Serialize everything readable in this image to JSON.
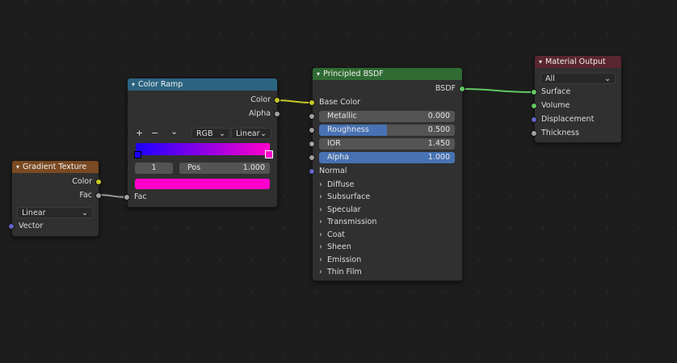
{
  "nodes": {
    "gradient": {
      "title": "Gradient Texture",
      "color_header": "#7a4a22",
      "outputs": {
        "color": "Color",
        "fac": "Fac"
      },
      "type_value": "Linear",
      "input_vector": "Vector"
    },
    "colorramp": {
      "title": "Color Ramp",
      "color_header": "#2b6482",
      "outputs": {
        "color": "Color",
        "alpha": "Alpha"
      },
      "toolbar": {
        "add": "+",
        "remove": "−",
        "menu": "⌄"
      },
      "color_mode": "RGB",
      "interpolation": "Linear",
      "stop_index": "1",
      "pos_label": "Pos",
      "pos_value": "1.000",
      "ramp_start_color": "#1a00ff",
      "ramp_end_color": "#ff00cc",
      "active_color": "#ff00cc",
      "input_fac": "Fac"
    },
    "principled": {
      "title": "Principled BSDF",
      "color_header": "#2f6b32",
      "output_bsdf": "BSDF",
      "base_color": "Base Color",
      "metallic": {
        "label": "Metallic",
        "value": "0.000",
        "fill": 0
      },
      "roughness": {
        "label": "Roughness",
        "value": "0.500",
        "fill": 0.5
      },
      "ior": {
        "label": "IOR",
        "value": "1.450",
        "fill": 0
      },
      "alpha": {
        "label": "Alpha",
        "value": "1.000",
        "fill": 1
      },
      "normal": "Normal",
      "panels": [
        "Diffuse",
        "Subsurface",
        "Specular",
        "Transmission",
        "Coat",
        "Sheen",
        "Emission",
        "Thin Film"
      ]
    },
    "output": {
      "title": "Material Output",
      "color_header": "#5a2630",
      "target": "All",
      "inputs": [
        "Surface",
        "Volume",
        "Displacement",
        "Thickness"
      ]
    }
  }
}
